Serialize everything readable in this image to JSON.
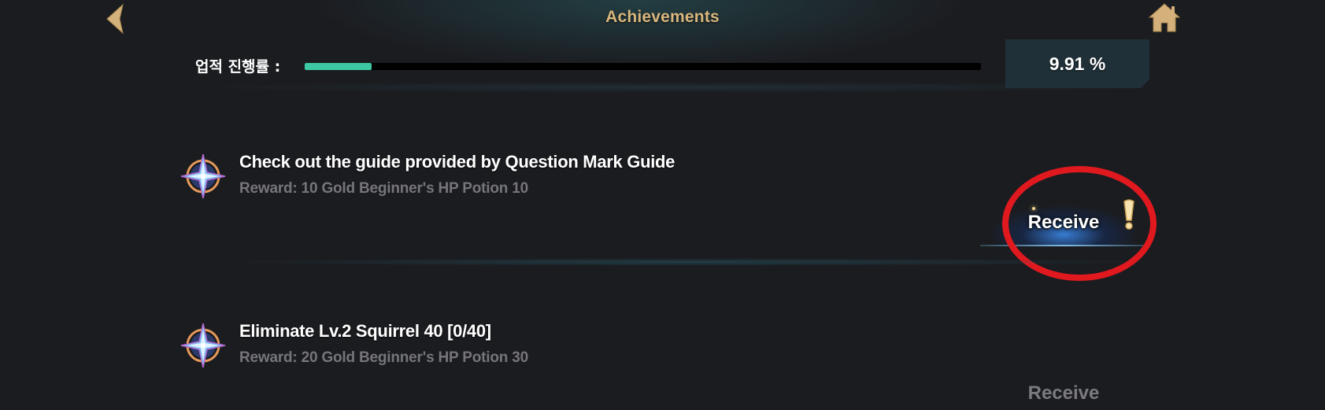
{
  "header": {
    "title": "Achievements",
    "back_icon": "back-arrow-icon",
    "home_icon": "home-icon"
  },
  "progress": {
    "label": "업적 진행률 :",
    "value_text": "9.91 %",
    "fraction": 0.0991
  },
  "achievements": [
    {
      "title": "Check out the guide provided by Question Mark Guide",
      "reward": "Reward: 10 Gold Beginner's HP Potion 10",
      "button_label": "Receive",
      "state": "claimable",
      "icon": "compass-star-icon"
    },
    {
      "title": "Eliminate Lv.2 Squirrel 40 [0/40]",
      "reward": "Reward: 20 Gold Beginner's HP Potion 30",
      "button_label": "Receive",
      "state": "disabled",
      "icon": "compass-star-icon"
    }
  ],
  "colors": {
    "title": "#d9b77e",
    "progress_fill": "#3dc7a2",
    "highlight_ring": "#e0191f",
    "notice": "#f0d08a"
  }
}
